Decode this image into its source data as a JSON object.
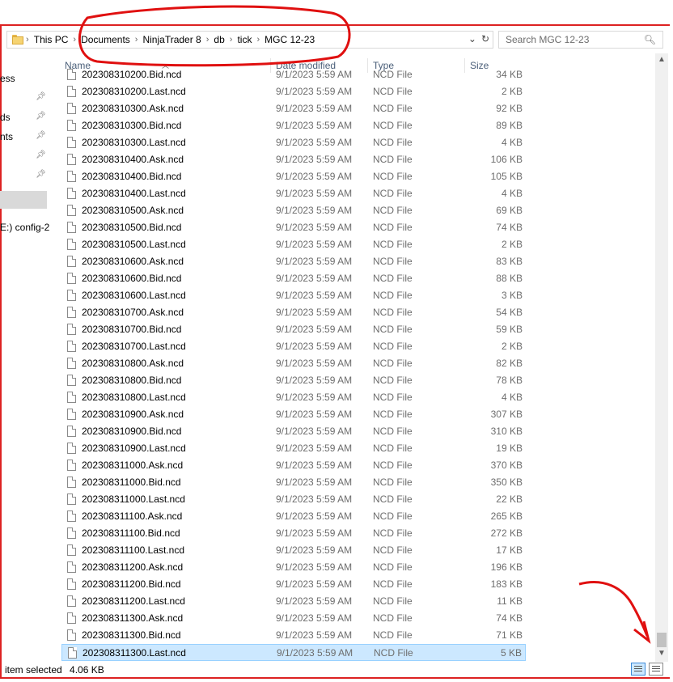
{
  "breadcrumb": [
    "This PC",
    "Documents",
    "NinjaTrader 8",
    "db",
    "tick",
    "MGC 12-23"
  ],
  "search": {
    "placeholder": "Search MGC 12-23"
  },
  "columns": {
    "name": "Name",
    "date": "Date modified",
    "type": "Type",
    "size": "Size"
  },
  "sidebar": {
    "items": [
      "ess",
      "ds",
      "nts",
      "E:) config-2"
    ]
  },
  "files": [
    {
      "name": "202308310200.Bid.ncd",
      "date": "9/1/2023 5:59 AM",
      "type": "NCD File",
      "size": "34 KB"
    },
    {
      "name": "202308310200.Last.ncd",
      "date": "9/1/2023 5:59 AM",
      "type": "NCD File",
      "size": "2 KB"
    },
    {
      "name": "202308310300.Ask.ncd",
      "date": "9/1/2023 5:59 AM",
      "type": "NCD File",
      "size": "92 KB"
    },
    {
      "name": "202308310300.Bid.ncd",
      "date": "9/1/2023 5:59 AM",
      "type": "NCD File",
      "size": "89 KB"
    },
    {
      "name": "202308310300.Last.ncd",
      "date": "9/1/2023 5:59 AM",
      "type": "NCD File",
      "size": "4 KB"
    },
    {
      "name": "202308310400.Ask.ncd",
      "date": "9/1/2023 5:59 AM",
      "type": "NCD File",
      "size": "106 KB"
    },
    {
      "name": "202308310400.Bid.ncd",
      "date": "9/1/2023 5:59 AM",
      "type": "NCD File",
      "size": "105 KB"
    },
    {
      "name": "202308310400.Last.ncd",
      "date": "9/1/2023 5:59 AM",
      "type": "NCD File",
      "size": "4 KB"
    },
    {
      "name": "202308310500.Ask.ncd",
      "date": "9/1/2023 5:59 AM",
      "type": "NCD File",
      "size": "69 KB"
    },
    {
      "name": "202308310500.Bid.ncd",
      "date": "9/1/2023 5:59 AM",
      "type": "NCD File",
      "size": "74 KB"
    },
    {
      "name": "202308310500.Last.ncd",
      "date": "9/1/2023 5:59 AM",
      "type": "NCD File",
      "size": "2 KB"
    },
    {
      "name": "202308310600.Ask.ncd",
      "date": "9/1/2023 5:59 AM",
      "type": "NCD File",
      "size": "83 KB"
    },
    {
      "name": "202308310600.Bid.ncd",
      "date": "9/1/2023 5:59 AM",
      "type": "NCD File",
      "size": "88 KB"
    },
    {
      "name": "202308310600.Last.ncd",
      "date": "9/1/2023 5:59 AM",
      "type": "NCD File",
      "size": "3 KB"
    },
    {
      "name": "202308310700.Ask.ncd",
      "date": "9/1/2023 5:59 AM",
      "type": "NCD File",
      "size": "54 KB"
    },
    {
      "name": "202308310700.Bid.ncd",
      "date": "9/1/2023 5:59 AM",
      "type": "NCD File",
      "size": "59 KB"
    },
    {
      "name": "202308310700.Last.ncd",
      "date": "9/1/2023 5:59 AM",
      "type": "NCD File",
      "size": "2 KB"
    },
    {
      "name": "202308310800.Ask.ncd",
      "date": "9/1/2023 5:59 AM",
      "type": "NCD File",
      "size": "82 KB"
    },
    {
      "name": "202308310800.Bid.ncd",
      "date": "9/1/2023 5:59 AM",
      "type": "NCD File",
      "size": "78 KB"
    },
    {
      "name": "202308310800.Last.ncd",
      "date": "9/1/2023 5:59 AM",
      "type": "NCD File",
      "size": "4 KB"
    },
    {
      "name": "202308310900.Ask.ncd",
      "date": "9/1/2023 5:59 AM",
      "type": "NCD File",
      "size": "307 KB"
    },
    {
      "name": "202308310900.Bid.ncd",
      "date": "9/1/2023 5:59 AM",
      "type": "NCD File",
      "size": "310 KB"
    },
    {
      "name": "202308310900.Last.ncd",
      "date": "9/1/2023 5:59 AM",
      "type": "NCD File",
      "size": "19 KB"
    },
    {
      "name": "202308311000.Ask.ncd",
      "date": "9/1/2023 5:59 AM",
      "type": "NCD File",
      "size": "370 KB"
    },
    {
      "name": "202308311000.Bid.ncd",
      "date": "9/1/2023 5:59 AM",
      "type": "NCD File",
      "size": "350 KB"
    },
    {
      "name": "202308311000.Last.ncd",
      "date": "9/1/2023 5:59 AM",
      "type": "NCD File",
      "size": "22 KB"
    },
    {
      "name": "202308311100.Ask.ncd",
      "date": "9/1/2023 5:59 AM",
      "type": "NCD File",
      "size": "265 KB"
    },
    {
      "name": "202308311100.Bid.ncd",
      "date": "9/1/2023 5:59 AM",
      "type": "NCD File",
      "size": "272 KB"
    },
    {
      "name": "202308311100.Last.ncd",
      "date": "9/1/2023 5:59 AM",
      "type": "NCD File",
      "size": "17 KB"
    },
    {
      "name": "202308311200.Ask.ncd",
      "date": "9/1/2023 5:59 AM",
      "type": "NCD File",
      "size": "196 KB"
    },
    {
      "name": "202308311200.Bid.ncd",
      "date": "9/1/2023 5:59 AM",
      "type": "NCD File",
      "size": "183 KB"
    },
    {
      "name": "202308311200.Last.ncd",
      "date": "9/1/2023 5:59 AM",
      "type": "NCD File",
      "size": "11 KB"
    },
    {
      "name": "202308311300.Ask.ncd",
      "date": "9/1/2023 5:59 AM",
      "type": "NCD File",
      "size": "74 KB"
    },
    {
      "name": "202308311300.Bid.ncd",
      "date": "9/1/2023 5:59 AM",
      "type": "NCD File",
      "size": "71 KB"
    },
    {
      "name": "202308311300.Last.ncd",
      "date": "9/1/2023 5:59 AM",
      "type": "NCD File",
      "size": "5 KB",
      "selected": true
    }
  ],
  "status": {
    "selection": "item selected",
    "size": "4.06 KB"
  },
  "colors": {
    "selected_row": "#cce8ff",
    "annotation": "#e01010",
    "header_text": "#4c607a"
  }
}
